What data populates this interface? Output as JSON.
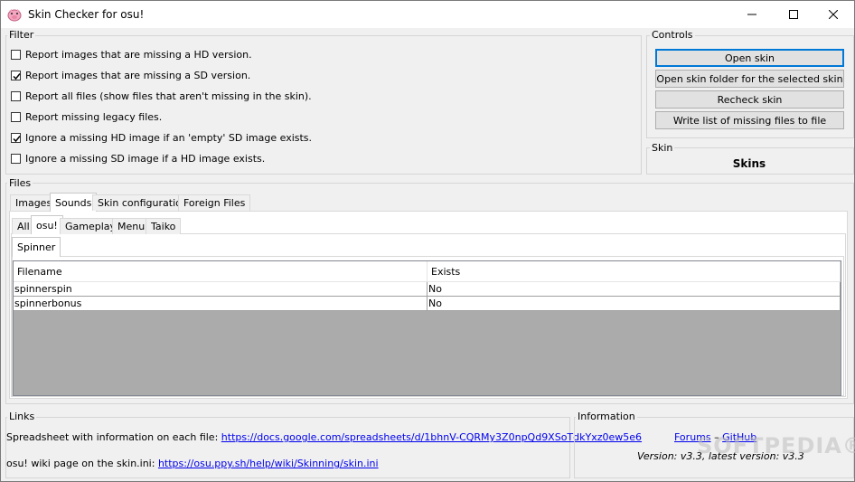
{
  "window": {
    "title": "Skin Checker for osu!",
    "minimize": "—",
    "maximize": "☐",
    "close": "✕"
  },
  "filter": {
    "label": "Filter",
    "options": [
      {
        "label": "Report images that are missing a HD version.",
        "checked": false
      },
      {
        "label": "Report images that are missing a SD version.",
        "checked": true
      },
      {
        "label": "Report all files (show files that aren't missing in the skin).",
        "checked": false
      },
      {
        "label": "Report missing legacy files.",
        "checked": false
      },
      {
        "label": "Ignore a missing HD image if an 'empty' SD image exists.",
        "checked": true
      },
      {
        "label": "Ignore a missing SD image if a HD image exists.",
        "checked": false
      }
    ]
  },
  "controls": {
    "label": "Controls",
    "open_skin": "Open skin",
    "open_folder": "Open skin folder for the selected skin",
    "recheck": "Recheck skin",
    "write_list": "Write list of missing files to file"
  },
  "skin": {
    "label": "Skin",
    "name": "Skins"
  },
  "files": {
    "label": "Files",
    "tabs": [
      "Images",
      "Sounds",
      "Skin configuration",
      "Foreign Files"
    ],
    "active_tab": "Sounds",
    "subtabs": [
      "All",
      "osu!",
      "Gameplay",
      "Menu",
      "Taiko"
    ],
    "active_subtab": "osu!",
    "subsubtabs": [
      "Spinner"
    ],
    "columns": [
      "Filename",
      "Exists"
    ],
    "rows": [
      {
        "filename": "spinnerspin",
        "exists": "No"
      },
      {
        "filename": "spinnerbonus",
        "exists": "No"
      }
    ]
  },
  "links": {
    "label": "Links",
    "spreadsheet_text": "Spreadsheet with information on each file: ",
    "spreadsheet_url": "https://docs.google.com/spreadsheets/d/1bhnV-CQRMy3Z0npQd9XSoTdkYxz0ew5e6",
    "wiki_text": "osu! wiki page on the skin.ini: ",
    "wiki_url": "https://osu.ppy.sh/help/wiki/Skinning/skin.ini"
  },
  "information": {
    "label": "Information",
    "forums": "Forums",
    "separator": " – ",
    "github": "GitHub",
    "version": "Version: v3.3, latest version: v3.3"
  },
  "watermark": "SOFTPEDIA®",
  "colors": {
    "accent": "#0078d7",
    "link": "#0000ee"
  }
}
